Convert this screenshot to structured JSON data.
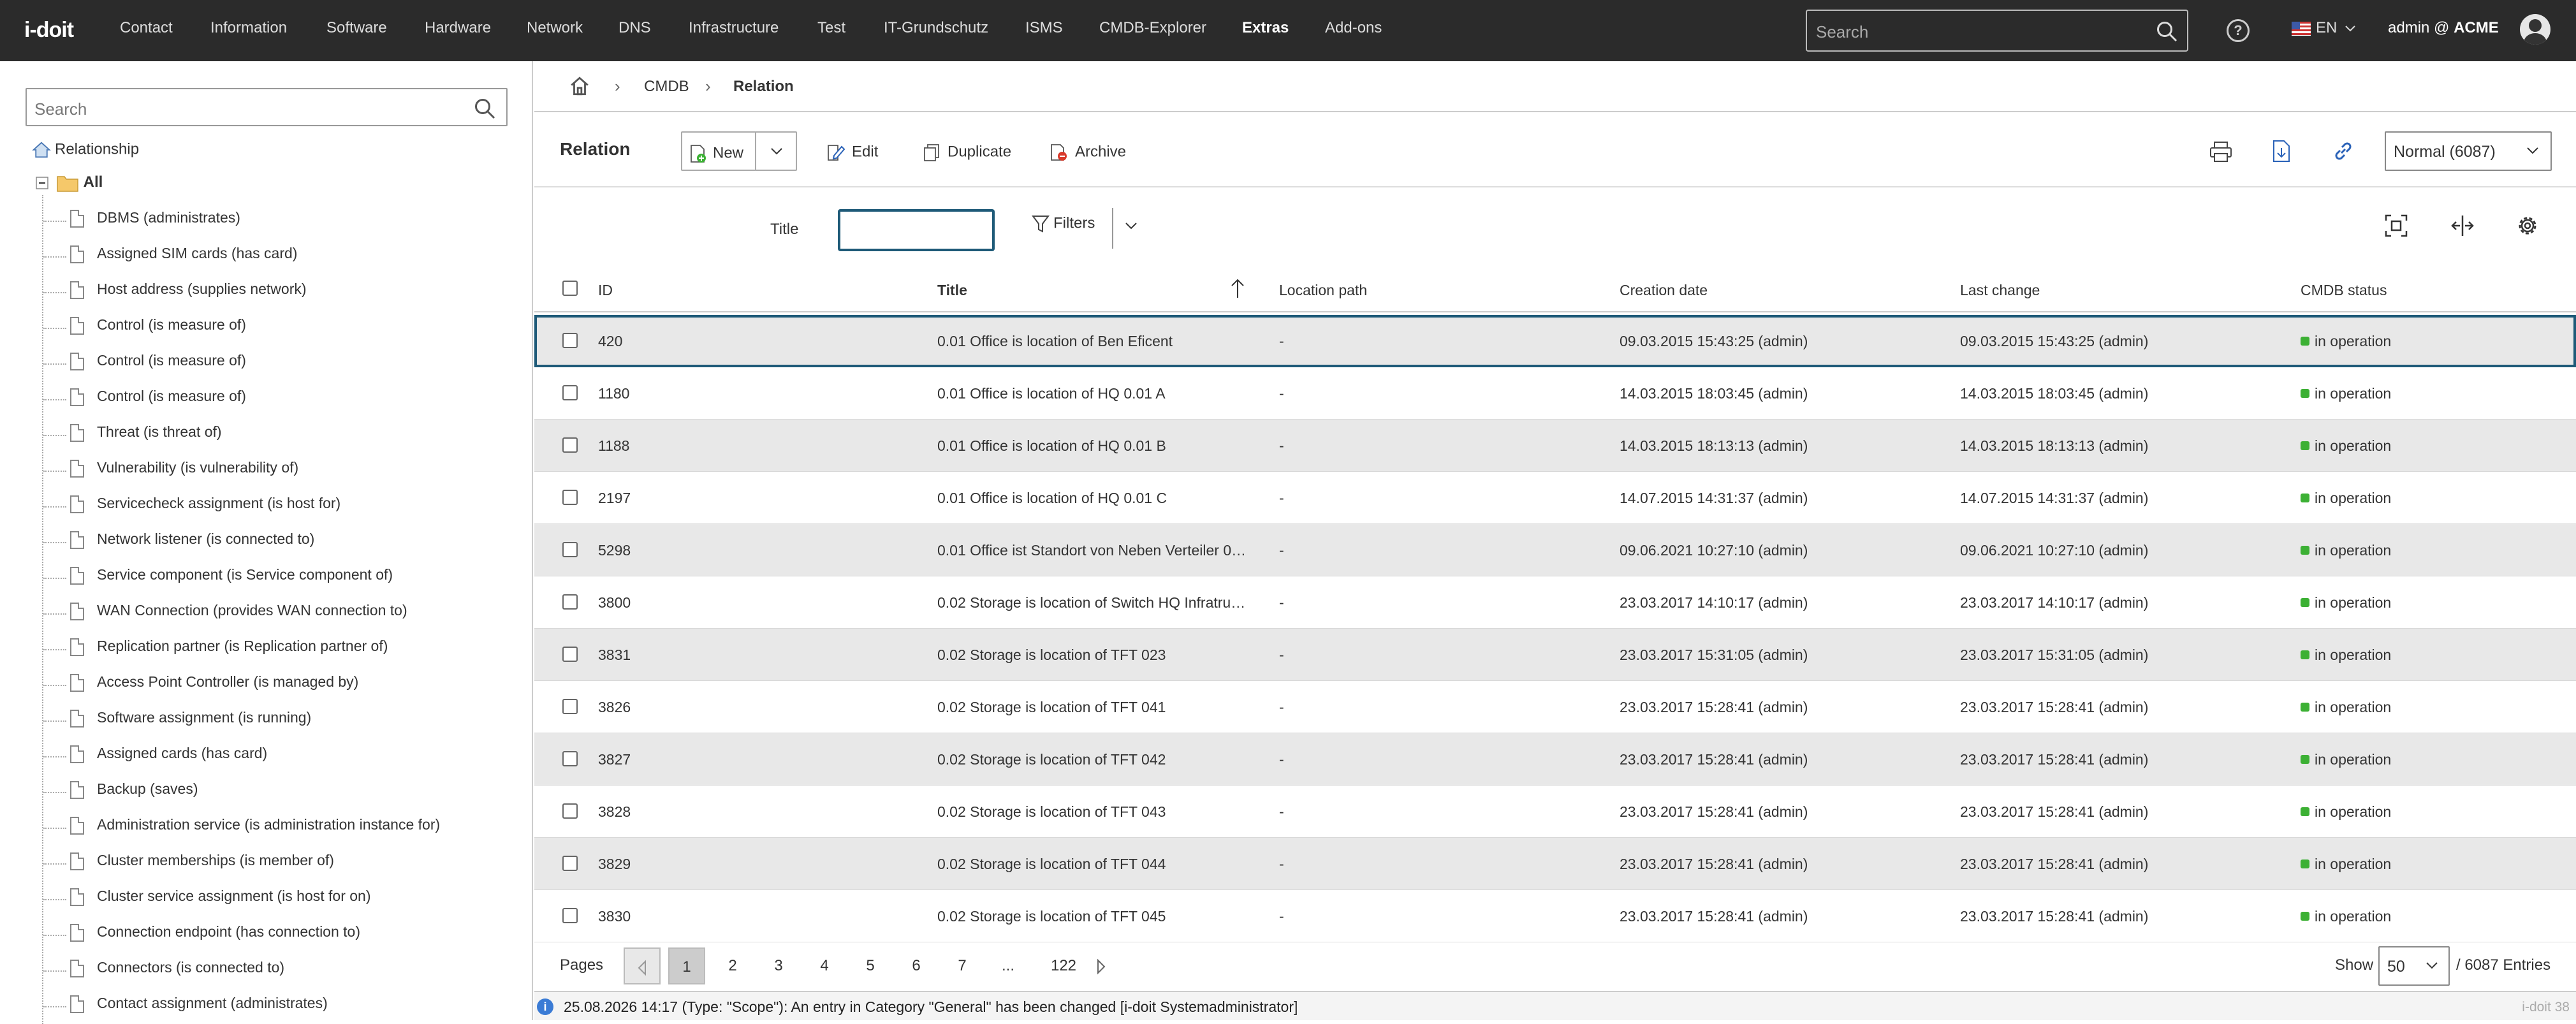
{
  "app": {
    "logo": "i-doit"
  },
  "nav": {
    "items": [
      "Contact",
      "Information",
      "Software",
      "Hardware",
      "Network",
      "DNS",
      "Infrastructure",
      "Test",
      "IT-Grundschutz",
      "ISMS",
      "CMDB-Explorer",
      "Extras",
      "Add-ons"
    ],
    "active": "Extras",
    "search_placeholder": "Search",
    "language": "EN",
    "user_prefix": "admin @",
    "tenant": "ACME"
  },
  "sidebar": {
    "search_placeholder": "Search",
    "root": "Relationship",
    "all": "All",
    "items": [
      "DBMS (administrates)",
      "Assigned SIM cards (has card)",
      "Host address (supplies network)",
      "Control (is measure of)",
      "Control (is measure of)",
      "Control (is measure of)",
      "Threat (is threat of)",
      "Vulnerability (is vulnerability of)",
      "Servicecheck assignment (is host for)",
      "Network listener (is connected to)",
      "Service component (is Service component of)",
      "WAN Connection (provides WAN connection to)",
      "Replication partner (is Replication partner of)",
      "Access Point Controller (is managed by)",
      "Software assignment (is running)",
      "Assigned cards (has card)",
      "Backup (saves)",
      "Administration service (is administration instance for)",
      "Cluster memberships (is member of)",
      "Cluster service assignment (is host for on)",
      "Connection endpoint (has connection to)",
      "Connectors (is connected to)",
      "Contact assignment (administrates)"
    ]
  },
  "breadcrumb": {
    "items": [
      "CMDB",
      "Relation"
    ]
  },
  "toolbar": {
    "title": "Relation",
    "new_label": "New",
    "edit_label": "Edit",
    "duplicate_label": "Duplicate",
    "archive_label": "Archive",
    "view_select": "Normal (6087)"
  },
  "filter": {
    "title_label": "Title",
    "title_value": "",
    "filters_label": "Filters"
  },
  "table": {
    "columns": [
      "ID",
      "Title",
      "Location path",
      "Creation date",
      "Last change",
      "CMDB status"
    ],
    "rows": [
      [
        "420",
        "0.01 Office is location of Ben Eficent",
        "-",
        "09.03.2015 15:43:25 (admin)",
        "09.03.2015 15:43:25 (admin)",
        "in operation"
      ],
      [
        "1180",
        "0.01 Office is location of HQ 0.01 A",
        "-",
        "14.03.2015 18:03:45 (admin)",
        "14.03.2015 18:03:45 (admin)",
        "in operation"
      ],
      [
        "1188",
        "0.01 Office is location of HQ 0.01 B",
        "-",
        "14.03.2015 18:13:13 (admin)",
        "14.03.2015 18:13:13 (admin)",
        "in operation"
      ],
      [
        "2197",
        "0.01 Office is location of HQ 0.01 C",
        "-",
        "14.07.2015 14:31:37 (admin)",
        "14.07.2015 14:31:37 (admin)",
        "in operation"
      ],
      [
        "5298",
        "0.01 Office ist Standort von Neben Verteiler 0…",
        "-",
        "09.06.2021 10:27:10 (admin)",
        "09.06.2021 10:27:10 (admin)",
        "in operation"
      ],
      [
        "3800",
        "0.02 Storage is location of Switch HQ Infratru…",
        "-",
        "23.03.2017 14:10:17 (admin)",
        "23.03.2017 14:10:17 (admin)",
        "in operation"
      ],
      [
        "3831",
        "0.02 Storage is location of TFT 023",
        "-",
        "23.03.2017 15:31:05 (admin)",
        "23.03.2017 15:31:05 (admin)",
        "in operation"
      ],
      [
        "3826",
        "0.02 Storage is location of TFT 041",
        "-",
        "23.03.2017 15:28:41 (admin)",
        "23.03.2017 15:28:41 (admin)",
        "in operation"
      ],
      [
        "3827",
        "0.02 Storage is location of TFT 042",
        "-",
        "23.03.2017 15:28:41 (admin)",
        "23.03.2017 15:28:41 (admin)",
        "in operation"
      ],
      [
        "3828",
        "0.02 Storage is location of TFT 043",
        "-",
        "23.03.2017 15:28:41 (admin)",
        "23.03.2017 15:28:41 (admin)",
        "in operation"
      ],
      [
        "3829",
        "0.02 Storage is location of TFT 044",
        "-",
        "23.03.2017 15:28:41 (admin)",
        "23.03.2017 15:28:41 (admin)",
        "in operation"
      ],
      [
        "3830",
        "0.02 Storage is location of TFT 045",
        "-",
        "23.03.2017 15:28:41 (admin)",
        "23.03.2017 15:28:41 (admin)",
        "in operation"
      ]
    ],
    "status_color": "#3cb034",
    "selected_border_color": "#1e5a78"
  },
  "pager": {
    "label": "Pages",
    "pages": [
      "1",
      "2",
      "3",
      "4",
      "5",
      "6",
      "7",
      "...",
      "122"
    ],
    "current": "1",
    "show_label": "Show",
    "page_size": "50",
    "entries": "/ 6087 Entries"
  },
  "statusbar": {
    "message": "25.08.2026 14:17 (Type: \"Scope\"): An entry in Category \"General\" has been changed [i-doit Systemadministrator]",
    "version": "i-doit 38"
  },
  "colors": {
    "topbar": "#2b2b2b",
    "accent": "#1e5a78",
    "row_alt": "#e8e8e8",
    "brand_dot": "#e2231a"
  }
}
